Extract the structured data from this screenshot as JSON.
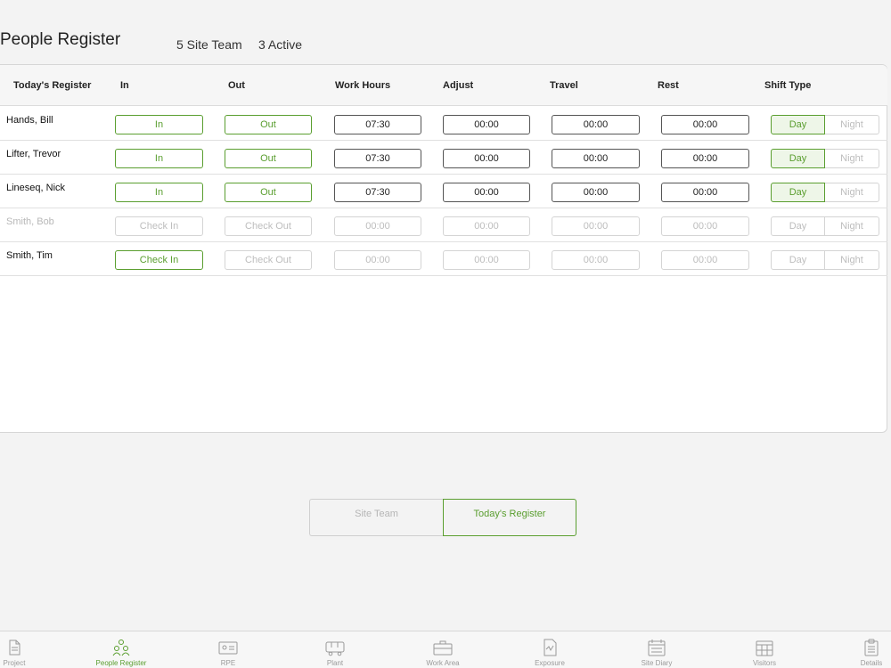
{
  "header": {
    "title": "People Register",
    "team_count": "5 Site Team",
    "active_count": "3 Active"
  },
  "register": {
    "columns": [
      "Today's Register",
      "In",
      "Out",
      "Work Hours",
      "Adjust",
      "Travel",
      "Rest",
      "Shift Type"
    ],
    "rows": [
      {
        "name": "Hands, Bill",
        "in": "In",
        "out": "Out",
        "work_hours": "07:30",
        "adjust": "00:00",
        "travel": "00:00",
        "rest": "00:00",
        "day": "Day",
        "night": "Night",
        "shift_selected": "Day",
        "state": "active"
      },
      {
        "name": "Lifter, Trevor",
        "in": "In",
        "out": "Out",
        "work_hours": "07:30",
        "adjust": "00:00",
        "travel": "00:00",
        "rest": "00:00",
        "day": "Day",
        "night": "Night",
        "shift_selected": "Day",
        "state": "active"
      },
      {
        "name": "Lineseq, Nick",
        "in": "In",
        "out": "Out",
        "work_hours": "07:30",
        "adjust": "00:00",
        "travel": "00:00",
        "rest": "00:00",
        "day": "Day",
        "night": "Night",
        "shift_selected": "Day",
        "state": "active"
      },
      {
        "name": "Smith, Bob",
        "in": "Check In",
        "out": "Check Out",
        "work_hours": "00:00",
        "adjust": "00:00",
        "travel": "00:00",
        "rest": "00:00",
        "day": "Day",
        "night": "Night",
        "shift_selected": "",
        "state": "disabled"
      },
      {
        "name": "Smith, Tim",
        "in": "Check In",
        "out": "Check Out",
        "work_hours": "00:00",
        "adjust": "00:00",
        "travel": "00:00",
        "rest": "00:00",
        "day": "Day",
        "night": "Night",
        "shift_selected": "",
        "state": "can-check-in"
      }
    ]
  },
  "view_switch": {
    "site_team": "Site Team",
    "todays_register": "Today's Register",
    "selected": "Today's Register"
  },
  "tabs": [
    {
      "label": "Project",
      "icon": "document-icon",
      "active": false
    },
    {
      "label": "People Register",
      "icon": "people-icon",
      "active": true
    },
    {
      "label": "RPE",
      "icon": "id-card-icon",
      "active": false
    },
    {
      "label": "Plant",
      "icon": "vehicle-icon",
      "active": false
    },
    {
      "label": "Work Area",
      "icon": "toolbox-icon",
      "active": false
    },
    {
      "label": "Exposure",
      "icon": "exposure-icon",
      "active": false
    },
    {
      "label": "Site Diary",
      "icon": "calendar-icon",
      "active": false
    },
    {
      "label": "Visitors",
      "icon": "calendar-grid-icon",
      "active": false
    },
    {
      "label": "Details",
      "icon": "clipboard-icon",
      "active": false
    }
  ],
  "colors": {
    "accent_green": "#5a9e2f",
    "faded_border": "#d4d4d4",
    "faded_text": "#bdbdbd",
    "background": "#f3f3f3"
  }
}
